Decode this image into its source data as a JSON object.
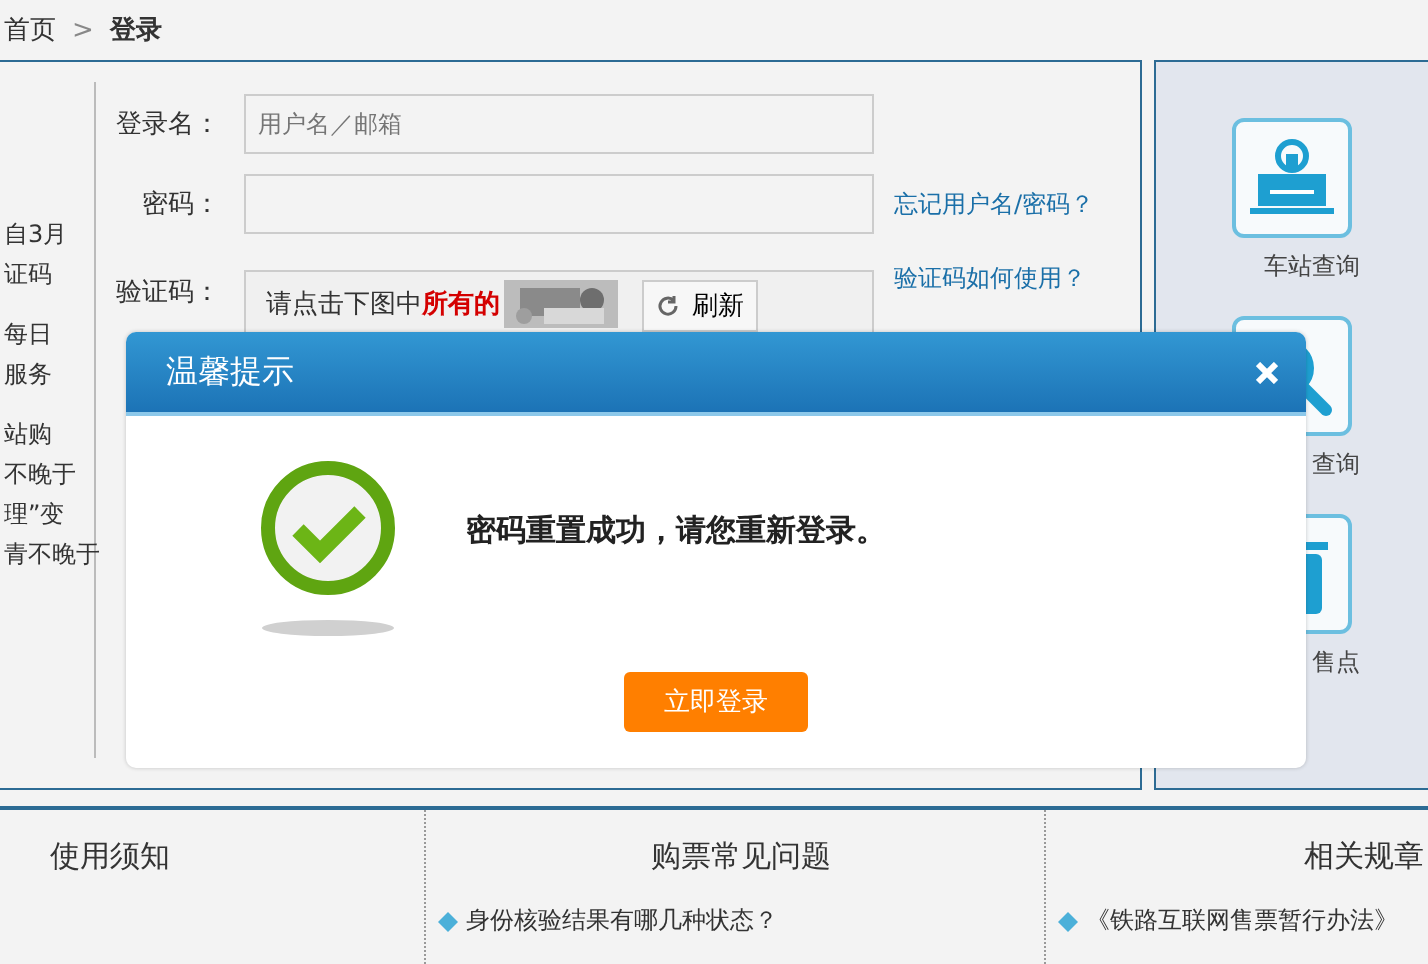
{
  "breadcrumb": {
    "items": [
      "首页",
      "登录"
    ],
    "separator": ">"
  },
  "notice_fragments": [
    "自3月",
    "证码",
    "每日",
    "服务",
    "站购",
    "不晚于",
    "理”变",
    "青不晚于"
  ],
  "login_form": {
    "fields": [
      {
        "label": "登录名：",
        "placeholder": "用户名／邮箱"
      },
      {
        "label": "密码：",
        "link": "忘记用户名/密码？"
      }
    ],
    "captcha": {
      "label": "验证码：",
      "prompt": "请点击下图中**所有的**",
      "refresh": "刷新",
      "link": "验证码如何使用？"
    }
  },
  "sidebar": {
    "items": [
      {
        "label": "车站查询",
        "kind": "station"
      },
      {
        "label": "查询",
        "kind": "price"
      },
      {
        "label": "售点",
        "kind": "outlet"
      }
    ]
  },
  "footer": {
    "columns": [
      {
        "title": "使用须知"
      },
      {
        "title": "购票常见问题",
        "links": [
          "身份核验结果有哪几种状态？"
        ]
      },
      {
        "title": "相关规章",
        "links": [
          "《铁路互联网售票暂行办法》"
        ]
      }
    ]
  },
  "dialog": {
    "title": "温馨提示",
    "message": "密码重置成功，请您重新登录。",
    "button": "立即登录"
  }
}
